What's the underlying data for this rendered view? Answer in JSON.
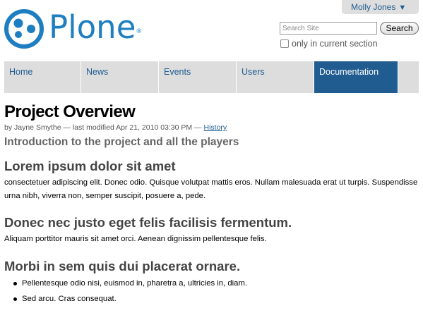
{
  "user": {
    "name": "Molly Jones",
    "caret": "▼"
  },
  "logo": {
    "text": "Plone",
    "reg": "®",
    "color": "#1d7ec1"
  },
  "search": {
    "placeholder": "Search Site",
    "button_label": "Search",
    "scope_label": "only in current section",
    "scope_checked": false
  },
  "nav": {
    "items": [
      {
        "label": "Home",
        "active": false
      },
      {
        "label": "News",
        "active": false
      },
      {
        "label": "Events",
        "active": false
      },
      {
        "label": "Users",
        "active": false
      },
      {
        "label": "Documentation",
        "active": true
      }
    ],
    "accent": "#205c90"
  },
  "page": {
    "title": "Project Overview",
    "byline": {
      "prefix": "by Jayne Smythe — last modified Apr 21, 2010 03:30 PM —",
      "history_link": "History"
    },
    "description": "Introduction to the project and all the players",
    "sections": [
      {
        "heading": "Lorem ipsum dolor sit amet",
        "body": "consectetuer adipiscing elit. Donec odio. Quisque volutpat mattis eros. Nullam malesuada erat ut turpis. Suspendisse urna nibh, viverra non, semper suscipit, posuere a, pede."
      },
      {
        "heading": "Donec nec justo eget felis facilisis fermentum.",
        "body": "Aliquam porttitor mauris sit amet orci. Aenean dignissim pellentesque felis."
      },
      {
        "heading": "Morbi in sem quis dui placerat ornare.",
        "bullets": [
          "Pellentesque odio nisi, euismod in, pharetra a, ultricies in, diam.",
          "Sed arcu. Cras consequat."
        ]
      }
    ]
  }
}
